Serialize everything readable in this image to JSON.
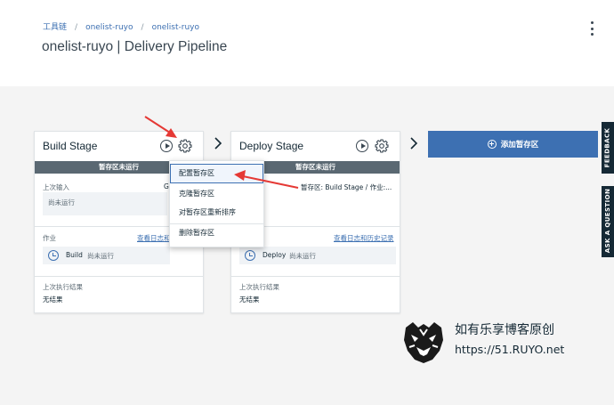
{
  "header": {
    "breadcrumbs": [
      "工具链",
      "onelist-ruyo",
      "onelist-ruyo"
    ],
    "separator": "/",
    "title": "onelist-ruyo | Delivery Pipeline"
  },
  "stages": [
    {
      "name": "Build Stage",
      "status": "暂存区未运行",
      "last_input_label": "上次输入",
      "last_input_value": "尚未运行",
      "last_input_trunc": "G",
      "jobs_label": "作业",
      "jobs_link": "查看日志和",
      "job_name": "Build",
      "job_status": "尚未运行",
      "last_result_label": "上次执行结果",
      "last_result_value": "无结果"
    },
    {
      "name": "Deploy Stage",
      "status": "暂存区未运行",
      "input_text": "暂存区: Build Stage  /  作业:...",
      "jobs_link": "查看日志和历史记录",
      "job_name": "Deploy",
      "job_status": "尚未运行",
      "last_result_label": "上次执行结果",
      "last_result_value": "无结果"
    }
  ],
  "add_stage_label": "添加暂存区",
  "menu": {
    "items": [
      "配置暂存区",
      "克隆暂存区",
      "对暂存区重新排序",
      "删除暂存区"
    ],
    "selected_index": 0
  },
  "side_tabs": {
    "feedback": "FEEDBACK",
    "ask": "ASK A QUESTION"
  },
  "watermark": {
    "line1": "如有乐享博客原创",
    "line2": "https://51.RUYO.net"
  },
  "colors": {
    "accent": "#3d70b2",
    "status_bar": "#5a6872",
    "arrow": "#e53935",
    "side_tab": "#152935"
  },
  "icons": [
    "play-icon",
    "gear-icon",
    "chevron-right-icon",
    "plus-circle-icon",
    "clock-icon",
    "kebab-menu-icon",
    "tiger-logo-icon"
  ]
}
